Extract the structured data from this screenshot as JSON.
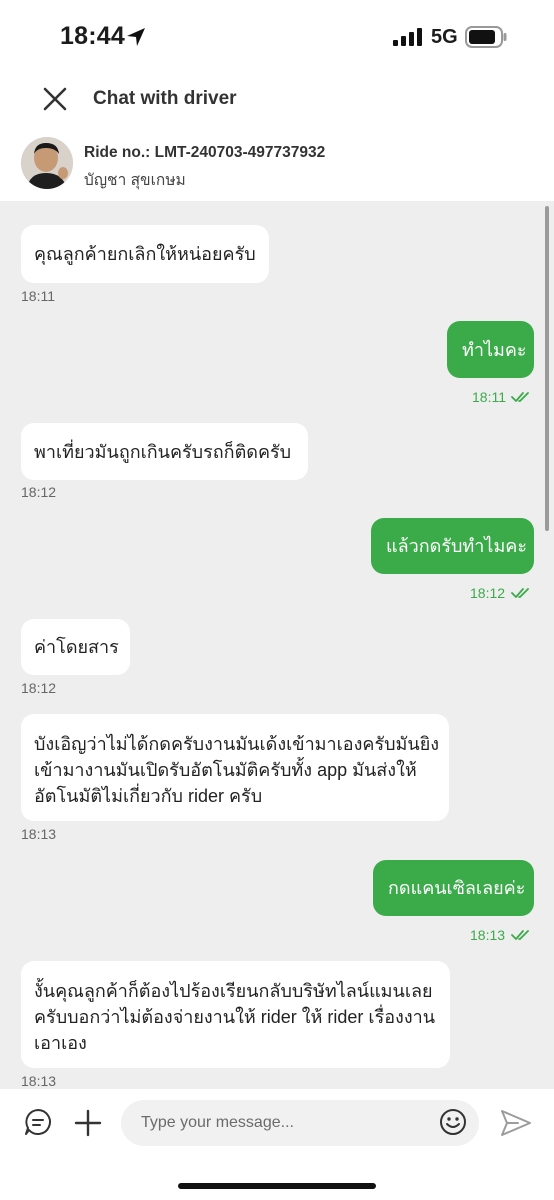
{
  "status_bar": {
    "time": "18:44",
    "network": "5G"
  },
  "header": {
    "title": "Chat with driver"
  },
  "driver": {
    "ride_no": "Ride no.: LMT-240703-497737932",
    "name": "บัญชา สุขเกษม"
  },
  "messages": [
    {
      "direction": "in",
      "lines": [
        "คุณลูกค้ายกเลิกให้หน่อยครับ"
      ],
      "time": "18:11"
    },
    {
      "direction": "out",
      "lines": [
        "ทำไมคะ"
      ],
      "time": "18:11"
    },
    {
      "direction": "in",
      "lines": [
        "พาเที่ยวมันถูกเกินครับรถก็ติดครับ"
      ],
      "time": "18:12"
    },
    {
      "direction": "out",
      "lines": [
        "แล้วกดรับทำไมคะ"
      ],
      "time": "18:12"
    },
    {
      "direction": "in",
      "lines": [
        "ค่าโดยสาร"
      ],
      "time": "18:12"
    },
    {
      "direction": "in",
      "lines": [
        "บังเอิญว่าไม่ได้กดครับงานมันเด้งเข้ามาเองครับมันยิง",
        "เข้ามางานมันเปิดรับอัตโนมัติครับทั้ง app มันส่งให้",
        "อัตโนมัติไม่เกี่ยวกับ rider ครับ"
      ],
      "time": "18:13"
    },
    {
      "direction": "out",
      "lines": [
        "กดแคนเซิลเลยค่ะ"
      ],
      "time": "18:13"
    },
    {
      "direction": "in",
      "lines": [
        "งั้นคุณลูกค้าก็ต้องไปร้องเรียนกลับบริษัทไลน์แมนเลย",
        "ครับบอกว่าไม่ต้องจ่ายงานให้ rider ให้ rider เรื่องงาน",
        "เอาเอง"
      ],
      "time": "18:13"
    }
  ],
  "input": {
    "placeholder": "Type your message..."
  },
  "icons": {
    "close": "close-icon",
    "location": "location-arrow-icon",
    "signal": "signal-icon",
    "battery": "battery-icon",
    "quick_reply": "chat-bubble-icon",
    "add": "plus-icon",
    "emoji": "smiley-icon",
    "send": "send-icon",
    "read": "double-check-icon"
  },
  "colors": {
    "accent": "#3bab4a",
    "chat_bg": "#eeeeee",
    "bubble_in": "#ffffff"
  }
}
